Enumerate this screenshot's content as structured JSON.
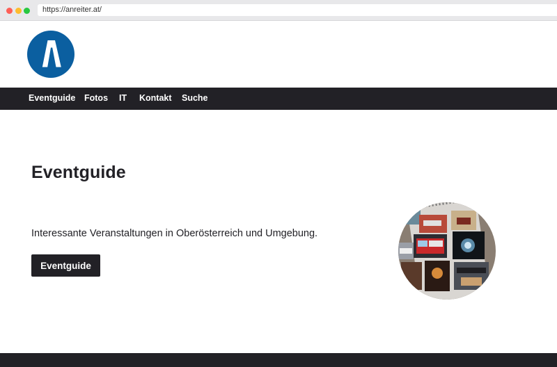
{
  "browser": {
    "url": "https://anreiter.at/"
  },
  "site": {
    "logo_icon": "anreiter-a-logo",
    "brand_color": "#0b5fa0"
  },
  "nav": {
    "items": [
      {
        "label": "Eventguide"
      },
      {
        "label": "Fotos"
      },
      {
        "label": "IT"
      },
      {
        "label": "Kontakt"
      },
      {
        "label": "Suche"
      }
    ]
  },
  "hero": {
    "title": "Eventguide",
    "text": "Interessante Veranstaltungen in Oberösterreich und Umgebung.",
    "button_label": "Eventguide",
    "image_icon": "event-photo-collage"
  },
  "colors": {
    "dark": "#222126",
    "background": "#ffffff"
  }
}
